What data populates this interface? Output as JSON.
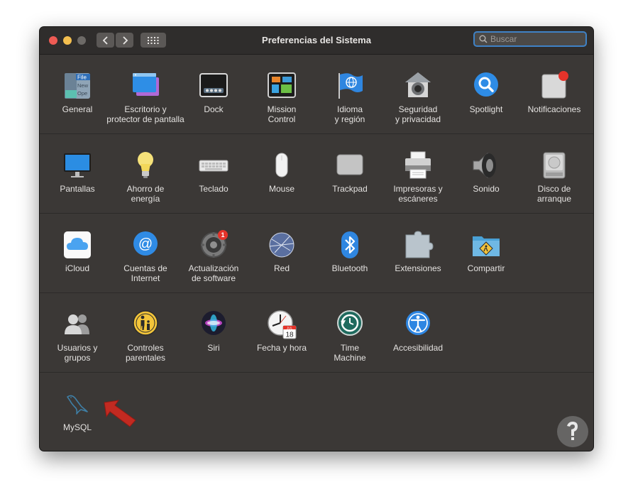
{
  "window": {
    "title": "Preferencias del Sistema"
  },
  "search": {
    "placeholder": "Buscar"
  },
  "rows": [
    [
      {
        "label": "General",
        "icon": "general-icon"
      },
      {
        "label": "Escritorio y\nprotector de pantalla",
        "icon": "desktop-screensaver-icon"
      },
      {
        "label": "Dock",
        "icon": "dock-icon"
      },
      {
        "label": "Mission\nControl",
        "icon": "mission-control-icon"
      },
      {
        "label": "Idioma\ny región",
        "icon": "language-region-icon"
      },
      {
        "label": "Seguridad\ny privacidad",
        "icon": "security-privacy-icon"
      },
      {
        "label": "Spotlight",
        "icon": "spotlight-icon"
      },
      {
        "label": "Notificaciones",
        "icon": "notifications-icon"
      }
    ],
    [
      {
        "label": "Pantallas",
        "icon": "displays-icon"
      },
      {
        "label": "Ahorro de\nenergía",
        "icon": "energy-saver-icon"
      },
      {
        "label": "Teclado",
        "icon": "keyboard-icon"
      },
      {
        "label": "Mouse",
        "icon": "mouse-icon"
      },
      {
        "label": "Trackpad",
        "icon": "trackpad-icon"
      },
      {
        "label": "Impresoras y\nescáneres",
        "icon": "printers-scanners-icon"
      },
      {
        "label": "Sonido",
        "icon": "sound-icon"
      },
      {
        "label": "Disco de\narranque",
        "icon": "startup-disk-icon"
      }
    ],
    [
      {
        "label": "iCloud",
        "icon": "icloud-icon"
      },
      {
        "label": "Cuentas de\nInternet",
        "icon": "internet-accounts-icon"
      },
      {
        "label": "Actualización\nde software",
        "icon": "software-update-icon",
        "badge": "1"
      },
      {
        "label": "Red",
        "icon": "network-icon"
      },
      {
        "label": "Bluetooth",
        "icon": "bluetooth-icon"
      },
      {
        "label": "Extensiones",
        "icon": "extensions-icon"
      },
      {
        "label": "Compartir",
        "icon": "sharing-icon"
      }
    ],
    [
      {
        "label": "Usuarios y\ngrupos",
        "icon": "users-groups-icon"
      },
      {
        "label": "Controles\nparentales",
        "icon": "parental-controls-icon"
      },
      {
        "label": "Siri",
        "icon": "siri-icon"
      },
      {
        "label": "Fecha y hora",
        "icon": "date-time-icon",
        "calendar_day": "18",
        "calendar_month": "JUL"
      },
      {
        "label": "Time\nMachine",
        "icon": "time-machine-icon"
      },
      {
        "label": "Accesibilidad",
        "icon": "accessibility-icon"
      }
    ],
    [
      {
        "label": "MySQL",
        "icon": "mysql-icon"
      }
    ]
  ],
  "colors": {
    "accent": "#3f82c6",
    "badge": "#e5332a",
    "arrow": "#c22a21",
    "window_bg": "#3b3836"
  }
}
